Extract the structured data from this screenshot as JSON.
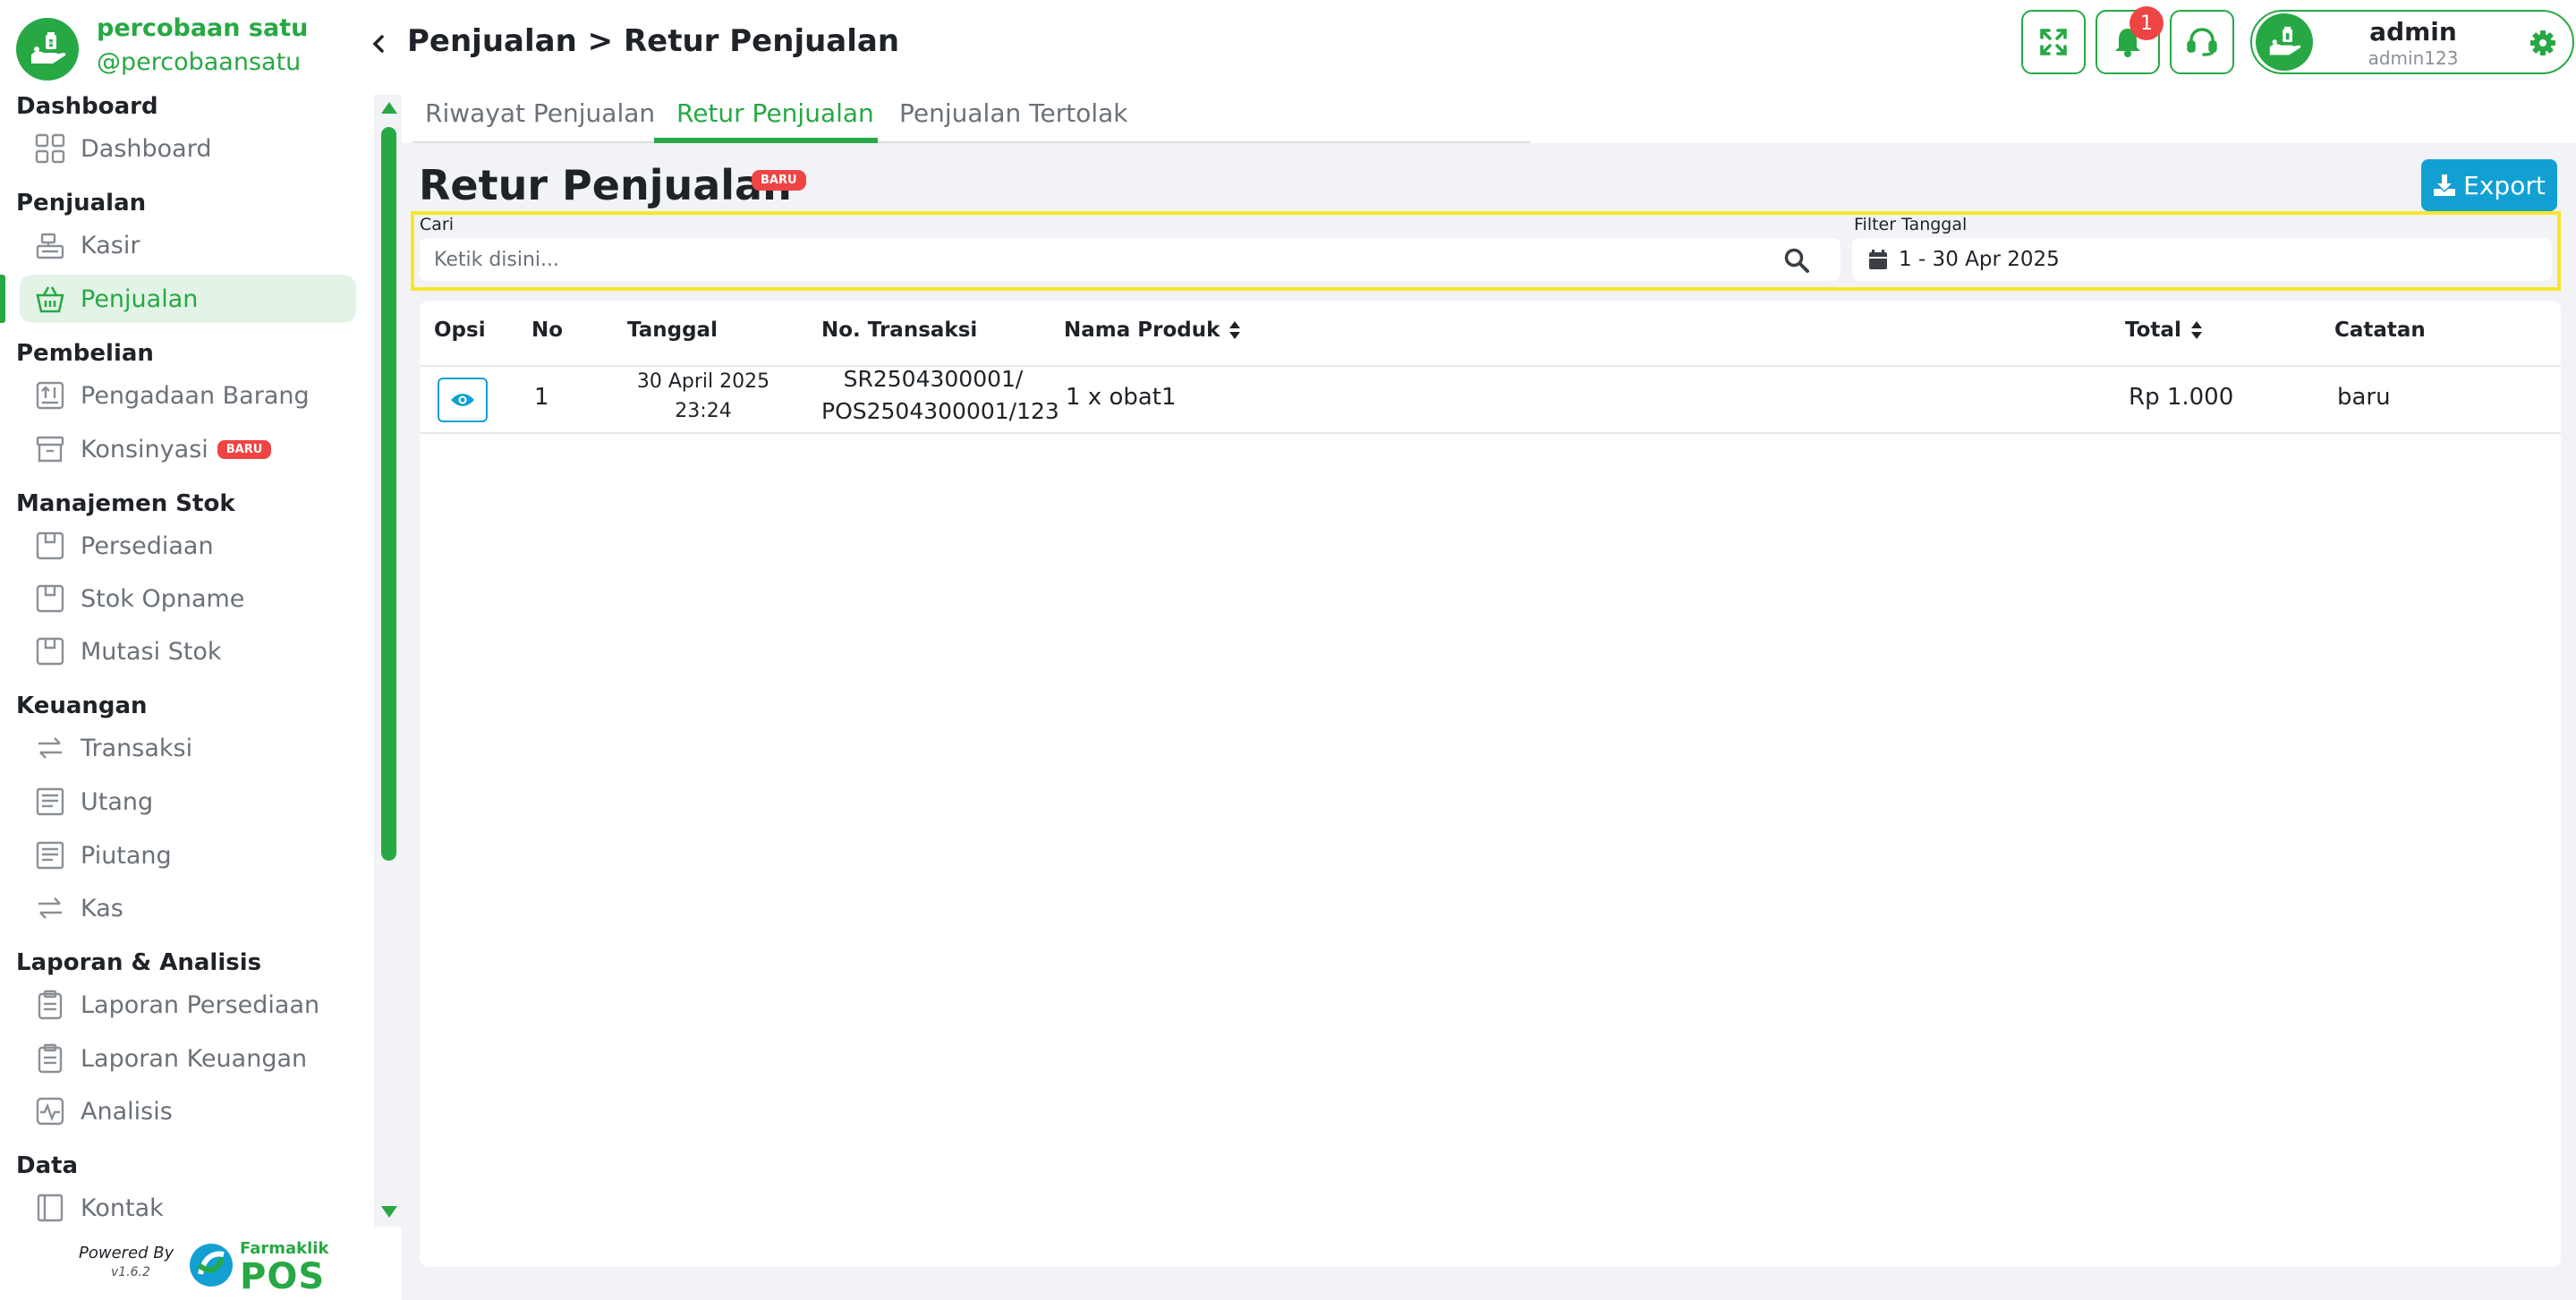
{
  "brand": {
    "name": "percobaan satu",
    "handle": "@percobaansatu"
  },
  "sidebar": {
    "sections": [
      {
        "title": "Dashboard",
        "items": [
          {
            "label": "Dashboard",
            "icon": "grid-icon"
          }
        ]
      },
      {
        "title": "Penjualan",
        "items": [
          {
            "label": "Kasir",
            "icon": "cash-register-icon"
          },
          {
            "label": "Penjualan",
            "icon": "shopping-basket-icon",
            "active": true
          }
        ]
      },
      {
        "title": "Pembelian",
        "items": [
          {
            "label": "Pengadaan Barang",
            "icon": "inbox-arrow-icon"
          },
          {
            "label": "Konsinyasi",
            "icon": "archive-box-icon",
            "badge": "BARU"
          }
        ]
      },
      {
        "title": "Manajemen Stok",
        "items": [
          {
            "label": "Persediaan",
            "icon": "box-icon"
          },
          {
            "label": "Stok Opname",
            "icon": "box-icon"
          },
          {
            "label": "Mutasi Stok",
            "icon": "box-icon"
          }
        ]
      },
      {
        "title": "Keuangan",
        "items": [
          {
            "label": "Transaksi",
            "icon": "transfer-arrows-icon"
          },
          {
            "label": "Utang",
            "icon": "receipt-icon"
          },
          {
            "label": "Piutang",
            "icon": "receipt-icon"
          },
          {
            "label": "Kas",
            "icon": "transfer-arrows-icon"
          }
        ]
      },
      {
        "title": "Laporan & Analisis",
        "items": [
          {
            "label": "Laporan Persediaan",
            "icon": "clipboard-icon"
          },
          {
            "label": "Laporan Keuangan",
            "icon": "clipboard-icon"
          },
          {
            "label": "Analisis",
            "icon": "activity-icon"
          }
        ]
      },
      {
        "title": "Data",
        "items": [
          {
            "label": "Kontak",
            "icon": "contact-book-icon"
          }
        ]
      }
    ],
    "powered_by": "Powered By",
    "version": "v1.6.2",
    "pos_brand": "Farmaklik",
    "pos_word": "POS"
  },
  "header": {
    "breadcrumb": "Penjualan > Retur Penjualan",
    "notification_count": "1",
    "user": {
      "name": "admin",
      "handle": "admin123"
    }
  },
  "tabs": [
    {
      "label": "Riwayat Penjualan",
      "active": false
    },
    {
      "label": "Retur Penjualan",
      "active": true
    },
    {
      "label": "Penjualan Tertolak",
      "active": false
    }
  ],
  "page": {
    "title": "Retur Penjualan",
    "title_badge": "BARU",
    "export_label": "Export",
    "search_label": "Cari",
    "search_placeholder": "Ketik disini...",
    "date_filter_label": "Filter Tanggal",
    "date_filter_value": "1 - 30 Apr 2025"
  },
  "table": {
    "columns": [
      "Opsi",
      "No",
      "Tanggal",
      "No. Transaksi",
      "Nama Produk",
      "Total",
      "Catatan"
    ],
    "rows": [
      {
        "no": "1",
        "date_line1": "30 April 2025",
        "date_line2": "23:24",
        "trx_line1": "SR2504300001/",
        "trx_line2": "POS2504300001/123",
        "product": "1 x obat1",
        "total": "Rp 1.000",
        "note": "baru"
      }
    ]
  },
  "colors": {
    "accent_green": "#27a844",
    "export_blue": "#12a0d3",
    "badge_red": "#ef4444",
    "highlight_yellow": "#f7e62c"
  }
}
